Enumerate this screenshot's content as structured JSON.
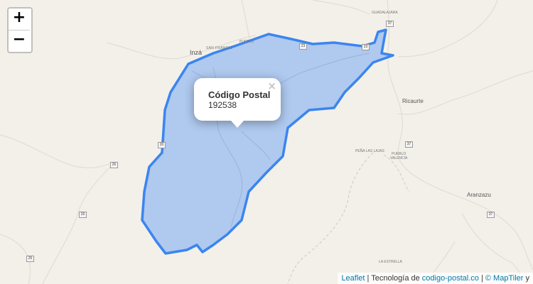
{
  "zoom": {
    "in_label": "+",
    "out_label": "−"
  },
  "popup": {
    "title": "Código Postal",
    "value": "192538",
    "close": "×"
  },
  "attribution": {
    "leaflet": "Leaflet",
    "sep1": " | Tecnología de ",
    "site": "codigo-postal.co",
    "sep2": " | ",
    "maptiler": "© MapTiler",
    "tail": " y"
  },
  "places": {
    "inza": "Inzá",
    "ricaurte": "Ricaurte",
    "aranzazu": "Aranzazu",
    "guadalajara": "GUADALAJARA",
    "san_francisco": "SAN FRANCIS",
    "pueblo": "PUEBLO",
    "valencia": "VALENCIA",
    "la_estrella": "LA ESTRELLA",
    "pena_lajas": "PEÑA LAS LAJAS"
  },
  "road_shields": {
    "r23": "23",
    "r37a": "37",
    "r37b": "37",
    "r37c": "37",
    "r26a": "26",
    "r26b": "26",
    "r26c": "26",
    "r20": "20",
    "r23b": "23"
  },
  "colors": {
    "area_fill": "#a7c4f0",
    "area_stroke": "#3b85ef"
  }
}
